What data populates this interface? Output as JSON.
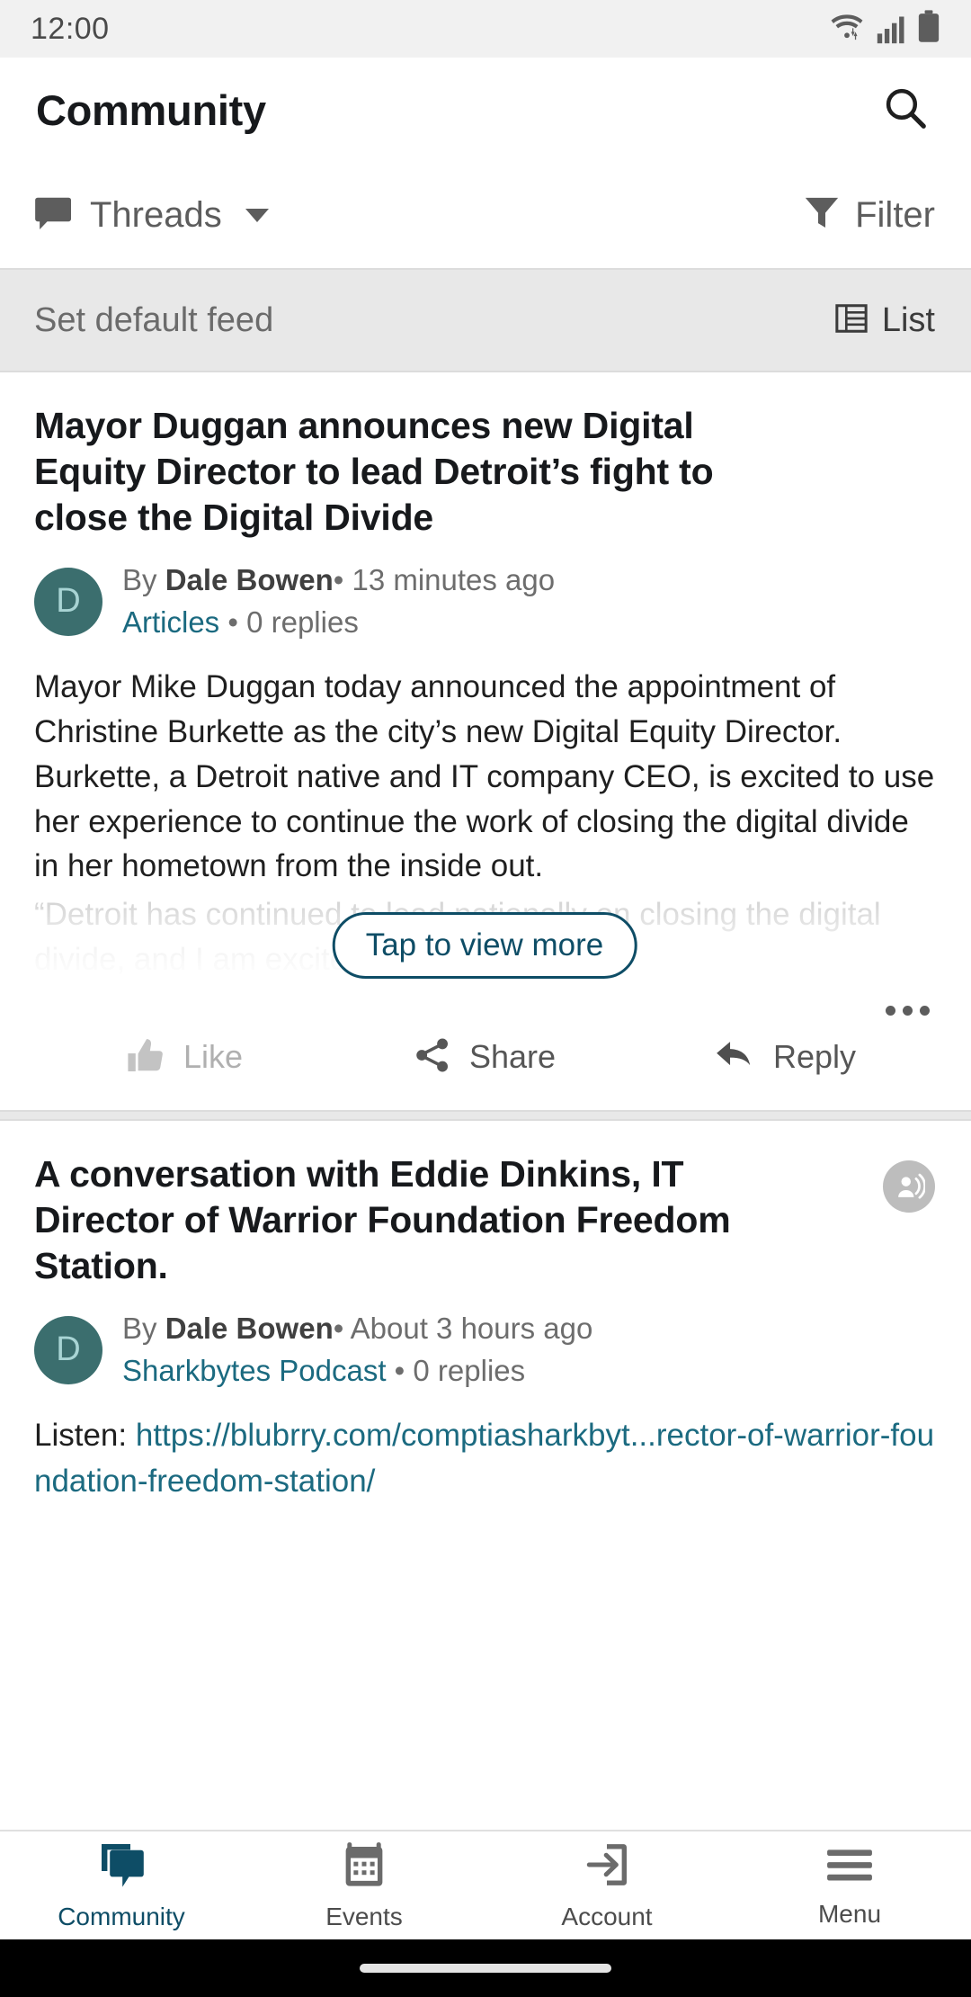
{
  "status_bar": {
    "time": "12:00",
    "icons": [
      "wifi-icon",
      "cellular-signal-icon",
      "battery-icon"
    ]
  },
  "header": {
    "title": "Community",
    "search_icon": "search-icon"
  },
  "feed_controls": {
    "feed_type_label": "Threads",
    "feed_type_icon": "speech-bubble-icon",
    "dropdown_icon": "chevron-down-icon",
    "filter_label": "Filter",
    "filter_icon": "funnel-icon"
  },
  "sub_bar": {
    "set_default_label": "Set default feed",
    "view_mode_label": "List",
    "view_mode_icon": "list-view-icon"
  },
  "posts": [
    {
      "title": "Mayor Duggan announces new Digital Equity Director to lead Detroit’s fight to close the Digital Divide",
      "avatar_initial": "D",
      "by_prefix": "By ",
      "author": "Dale Bowen",
      "separator": "• ",
      "timestamp": "13 minutes ago",
      "category": "Articles",
      "replies": "• 0 replies",
      "body": "Mayor Mike Duggan today announced the appointment of Christine Burkette as the city’s new Digital Equity Director. Burkette, a Detroit native and IT company CEO, is excited to use her experience to continue the work of closing the digital divide in her hometown from the inside out.",
      "faded_body": "“Detroit has continued to lead nationally on closing the digital divide, and I am excited",
      "tap_to_view_more": "Tap to view more",
      "overflow_icon": "more-options-icon",
      "actions": [
        {
          "label": "Like",
          "icon": "thumbs-up-icon",
          "muted": true
        },
        {
          "label": "Share",
          "icon": "share-icon",
          "muted": false
        },
        {
          "label": "Reply",
          "icon": "reply-arrow-icon",
          "muted": false
        }
      ]
    },
    {
      "title": "A conversation with Eddie Dinkins, IT Director of Warrior Foundation Freedom Station.",
      "badge_icon": "podcast-icon",
      "avatar_initial": "D",
      "by_prefix": "By ",
      "author": "Dale Bowen",
      "separator": "• ",
      "timestamp": "About 3 hours ago",
      "category": "Sharkbytes Podcast",
      "replies": "• 0 replies",
      "listen_prefix": "Listen: ",
      "listen_url_text": "https://blubrry.com/comptiasharkbyt...rector-of-warrior-foundation-freedom-station/"
    }
  ],
  "bottom_nav": [
    {
      "label": "Community",
      "icon": "speech-bubbles-icon",
      "active": true
    },
    {
      "label": "Events",
      "icon": "calendar-icon",
      "active": false
    },
    {
      "label": "Account",
      "icon": "login-arrow-icon",
      "active": false
    },
    {
      "label": "Menu",
      "icon": "hamburger-menu-icon",
      "active": false
    }
  ],
  "colors": {
    "accent": "#0e4d66",
    "link": "#1b6a80",
    "avatar_bg": "#3b6e6e",
    "avatar_fg": "#a8d4d4",
    "subbar_bg": "#e8e8e8",
    "statusbar_bg": "#f1f1f1"
  }
}
